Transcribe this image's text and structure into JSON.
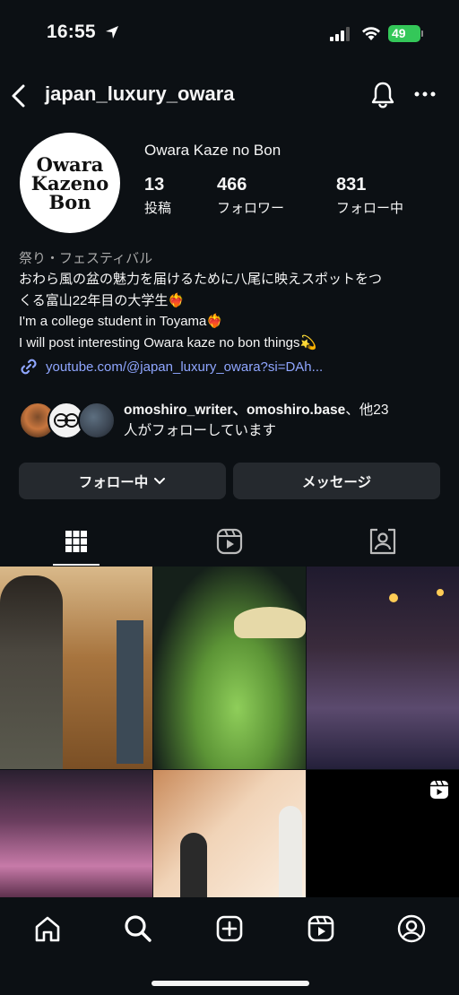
{
  "status": {
    "time": "16:55",
    "battery": "49"
  },
  "header": {
    "username": "japan_luxury_owara"
  },
  "profile": {
    "avatar_lines": [
      "Owara",
      "Kazeno",
      "Bon"
    ],
    "display_name": "Owara Kaze no Bon",
    "stats": [
      {
        "value": "13",
        "label": "投稿"
      },
      {
        "value": "466",
        "label": "フォロワー"
      },
      {
        "value": "831",
        "label": "フォロー中"
      }
    ],
    "category": "祭り・フェスティバル",
    "bio_lines": [
      "おわら風の盆の魅力を届けるために八尾に映えスポットをつ",
      "くる富山22年目の大学生❤️‍🔥",
      "I'm a college student in Toyama❤️‍🔥",
      "I will post interesting Owara kaze no bon things💫"
    ],
    "link": "youtube.com/@japan_luxury_owara?si=DAh..."
  },
  "followed_by": {
    "names": "omoshiro_writer、omoshiro.base",
    "suffix_line1": "、他23",
    "suffix_line2": "人がフォローしています"
  },
  "actions": {
    "following_label": "フォロー中",
    "message_label": "メッセージ"
  },
  "colors": {
    "background": "#0c1014",
    "button": "#25292e",
    "link": "#8fa6ff",
    "battery": "#34c759"
  }
}
